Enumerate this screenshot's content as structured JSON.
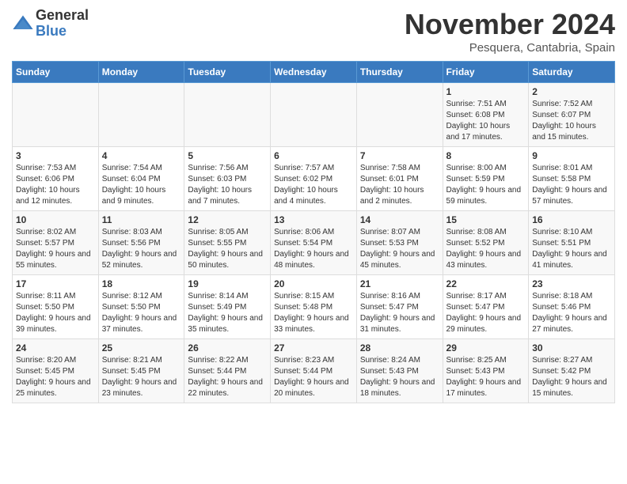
{
  "logo": {
    "general": "General",
    "blue": "Blue"
  },
  "title": "November 2024",
  "location": "Pesquera, Cantabria, Spain",
  "days_of_week": [
    "Sunday",
    "Monday",
    "Tuesday",
    "Wednesday",
    "Thursday",
    "Friday",
    "Saturday"
  ],
  "weeks": [
    [
      {
        "day": "",
        "content": ""
      },
      {
        "day": "",
        "content": ""
      },
      {
        "day": "",
        "content": ""
      },
      {
        "day": "",
        "content": ""
      },
      {
        "day": "",
        "content": ""
      },
      {
        "day": "1",
        "content": "Sunrise: 7:51 AM\nSunset: 6:08 PM\nDaylight: 10 hours and 17 minutes."
      },
      {
        "day": "2",
        "content": "Sunrise: 7:52 AM\nSunset: 6:07 PM\nDaylight: 10 hours and 15 minutes."
      }
    ],
    [
      {
        "day": "3",
        "content": "Sunrise: 7:53 AM\nSunset: 6:06 PM\nDaylight: 10 hours and 12 minutes."
      },
      {
        "day": "4",
        "content": "Sunrise: 7:54 AM\nSunset: 6:04 PM\nDaylight: 10 hours and 9 minutes."
      },
      {
        "day": "5",
        "content": "Sunrise: 7:56 AM\nSunset: 6:03 PM\nDaylight: 10 hours and 7 minutes."
      },
      {
        "day": "6",
        "content": "Sunrise: 7:57 AM\nSunset: 6:02 PM\nDaylight: 10 hours and 4 minutes."
      },
      {
        "day": "7",
        "content": "Sunrise: 7:58 AM\nSunset: 6:01 PM\nDaylight: 10 hours and 2 minutes."
      },
      {
        "day": "8",
        "content": "Sunrise: 8:00 AM\nSunset: 5:59 PM\nDaylight: 9 hours and 59 minutes."
      },
      {
        "day": "9",
        "content": "Sunrise: 8:01 AM\nSunset: 5:58 PM\nDaylight: 9 hours and 57 minutes."
      }
    ],
    [
      {
        "day": "10",
        "content": "Sunrise: 8:02 AM\nSunset: 5:57 PM\nDaylight: 9 hours and 55 minutes."
      },
      {
        "day": "11",
        "content": "Sunrise: 8:03 AM\nSunset: 5:56 PM\nDaylight: 9 hours and 52 minutes."
      },
      {
        "day": "12",
        "content": "Sunrise: 8:05 AM\nSunset: 5:55 PM\nDaylight: 9 hours and 50 minutes."
      },
      {
        "day": "13",
        "content": "Sunrise: 8:06 AM\nSunset: 5:54 PM\nDaylight: 9 hours and 48 minutes."
      },
      {
        "day": "14",
        "content": "Sunrise: 8:07 AM\nSunset: 5:53 PM\nDaylight: 9 hours and 45 minutes."
      },
      {
        "day": "15",
        "content": "Sunrise: 8:08 AM\nSunset: 5:52 PM\nDaylight: 9 hours and 43 minutes."
      },
      {
        "day": "16",
        "content": "Sunrise: 8:10 AM\nSunset: 5:51 PM\nDaylight: 9 hours and 41 minutes."
      }
    ],
    [
      {
        "day": "17",
        "content": "Sunrise: 8:11 AM\nSunset: 5:50 PM\nDaylight: 9 hours and 39 minutes."
      },
      {
        "day": "18",
        "content": "Sunrise: 8:12 AM\nSunset: 5:50 PM\nDaylight: 9 hours and 37 minutes."
      },
      {
        "day": "19",
        "content": "Sunrise: 8:14 AM\nSunset: 5:49 PM\nDaylight: 9 hours and 35 minutes."
      },
      {
        "day": "20",
        "content": "Sunrise: 8:15 AM\nSunset: 5:48 PM\nDaylight: 9 hours and 33 minutes."
      },
      {
        "day": "21",
        "content": "Sunrise: 8:16 AM\nSunset: 5:47 PM\nDaylight: 9 hours and 31 minutes."
      },
      {
        "day": "22",
        "content": "Sunrise: 8:17 AM\nSunset: 5:47 PM\nDaylight: 9 hours and 29 minutes."
      },
      {
        "day": "23",
        "content": "Sunrise: 8:18 AM\nSunset: 5:46 PM\nDaylight: 9 hours and 27 minutes."
      }
    ],
    [
      {
        "day": "24",
        "content": "Sunrise: 8:20 AM\nSunset: 5:45 PM\nDaylight: 9 hours and 25 minutes."
      },
      {
        "day": "25",
        "content": "Sunrise: 8:21 AM\nSunset: 5:45 PM\nDaylight: 9 hours and 23 minutes."
      },
      {
        "day": "26",
        "content": "Sunrise: 8:22 AM\nSunset: 5:44 PM\nDaylight: 9 hours and 22 minutes."
      },
      {
        "day": "27",
        "content": "Sunrise: 8:23 AM\nSunset: 5:44 PM\nDaylight: 9 hours and 20 minutes."
      },
      {
        "day": "28",
        "content": "Sunrise: 8:24 AM\nSunset: 5:43 PM\nDaylight: 9 hours and 18 minutes."
      },
      {
        "day": "29",
        "content": "Sunrise: 8:25 AM\nSunset: 5:43 PM\nDaylight: 9 hours and 17 minutes."
      },
      {
        "day": "30",
        "content": "Sunrise: 8:27 AM\nSunset: 5:42 PM\nDaylight: 9 hours and 15 minutes."
      }
    ]
  ]
}
